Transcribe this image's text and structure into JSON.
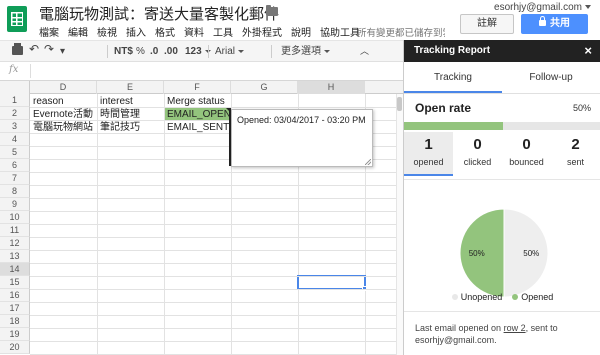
{
  "header": {
    "doc_title": "電腦玩物測試：寄送大量客製化郵件",
    "menu": [
      "檔案",
      "編輯",
      "檢視",
      "插入",
      "格式",
      "資料",
      "工具",
      "外掛程式",
      "說明",
      "協助工具"
    ],
    "save_status": "所有變更都已儲存到雲端硬碟。",
    "account": "esorhjy@gmail.com",
    "comments_label": "註解",
    "share_label": "共用"
  },
  "toolbar": {
    "currency": "$",
    "percent": "%",
    "decimal_dec": ".0",
    "decimal_inc": ".00",
    "more_formats": "123",
    "font": "Arial",
    "more": "更多選項",
    "collapse": "︿"
  },
  "formula": {
    "fx": "fx",
    "value": ""
  },
  "grid": {
    "columns": [
      "D",
      "E",
      "F",
      "G",
      "H"
    ],
    "rows": [
      "1",
      "2",
      "3",
      "4",
      "5",
      "6",
      "7",
      "8",
      "9",
      "10",
      "11",
      "12",
      "13",
      "14",
      "15",
      "16",
      "17",
      "18",
      "19",
      "20"
    ],
    "data": [
      [
        "reason",
        "interest",
        "Merge status"
      ],
      [
        "Evernote活動",
        "時間管理",
        "EMAIL_OPENED"
      ],
      [
        "電腦玩物網站",
        "筆記技巧",
        "EMAIL_SENT"
      ]
    ],
    "note": "Opened: 03/04/2017 - 03:20 PM"
  },
  "sidebar": {
    "title": "Tracking Report",
    "close": "×",
    "tabs": [
      "Tracking",
      "Follow-up"
    ],
    "open_rate_label": "Open rate",
    "open_rate_value": "50%",
    "open_rate_fraction": 0.5,
    "stats": [
      {
        "value": "1",
        "label": "opened"
      },
      {
        "value": "0",
        "label": "clicked"
      },
      {
        "value": "0",
        "label": "bounced"
      },
      {
        "value": "2",
        "label": "sent"
      }
    ],
    "pie": {
      "slices": [
        {
          "label": "Opened",
          "value": 50,
          "text": "50%",
          "color": "#93c47d"
        },
        {
          "label": "Unopened",
          "value": 50,
          "text": "50%",
          "color": "#eeeeee"
        }
      ]
    },
    "legend": [
      "Unopened",
      "Opened"
    ],
    "last_email": {
      "prefix": "Last email opened on",
      "row": "row 2",
      "suffix": ", sent to",
      "email": "esorhjy@gmail.com."
    }
  },
  "colors": {
    "accent": "#4a86e8",
    "green": "#93c47d",
    "share": "#4d90fe",
    "header_dark": "#222222"
  }
}
